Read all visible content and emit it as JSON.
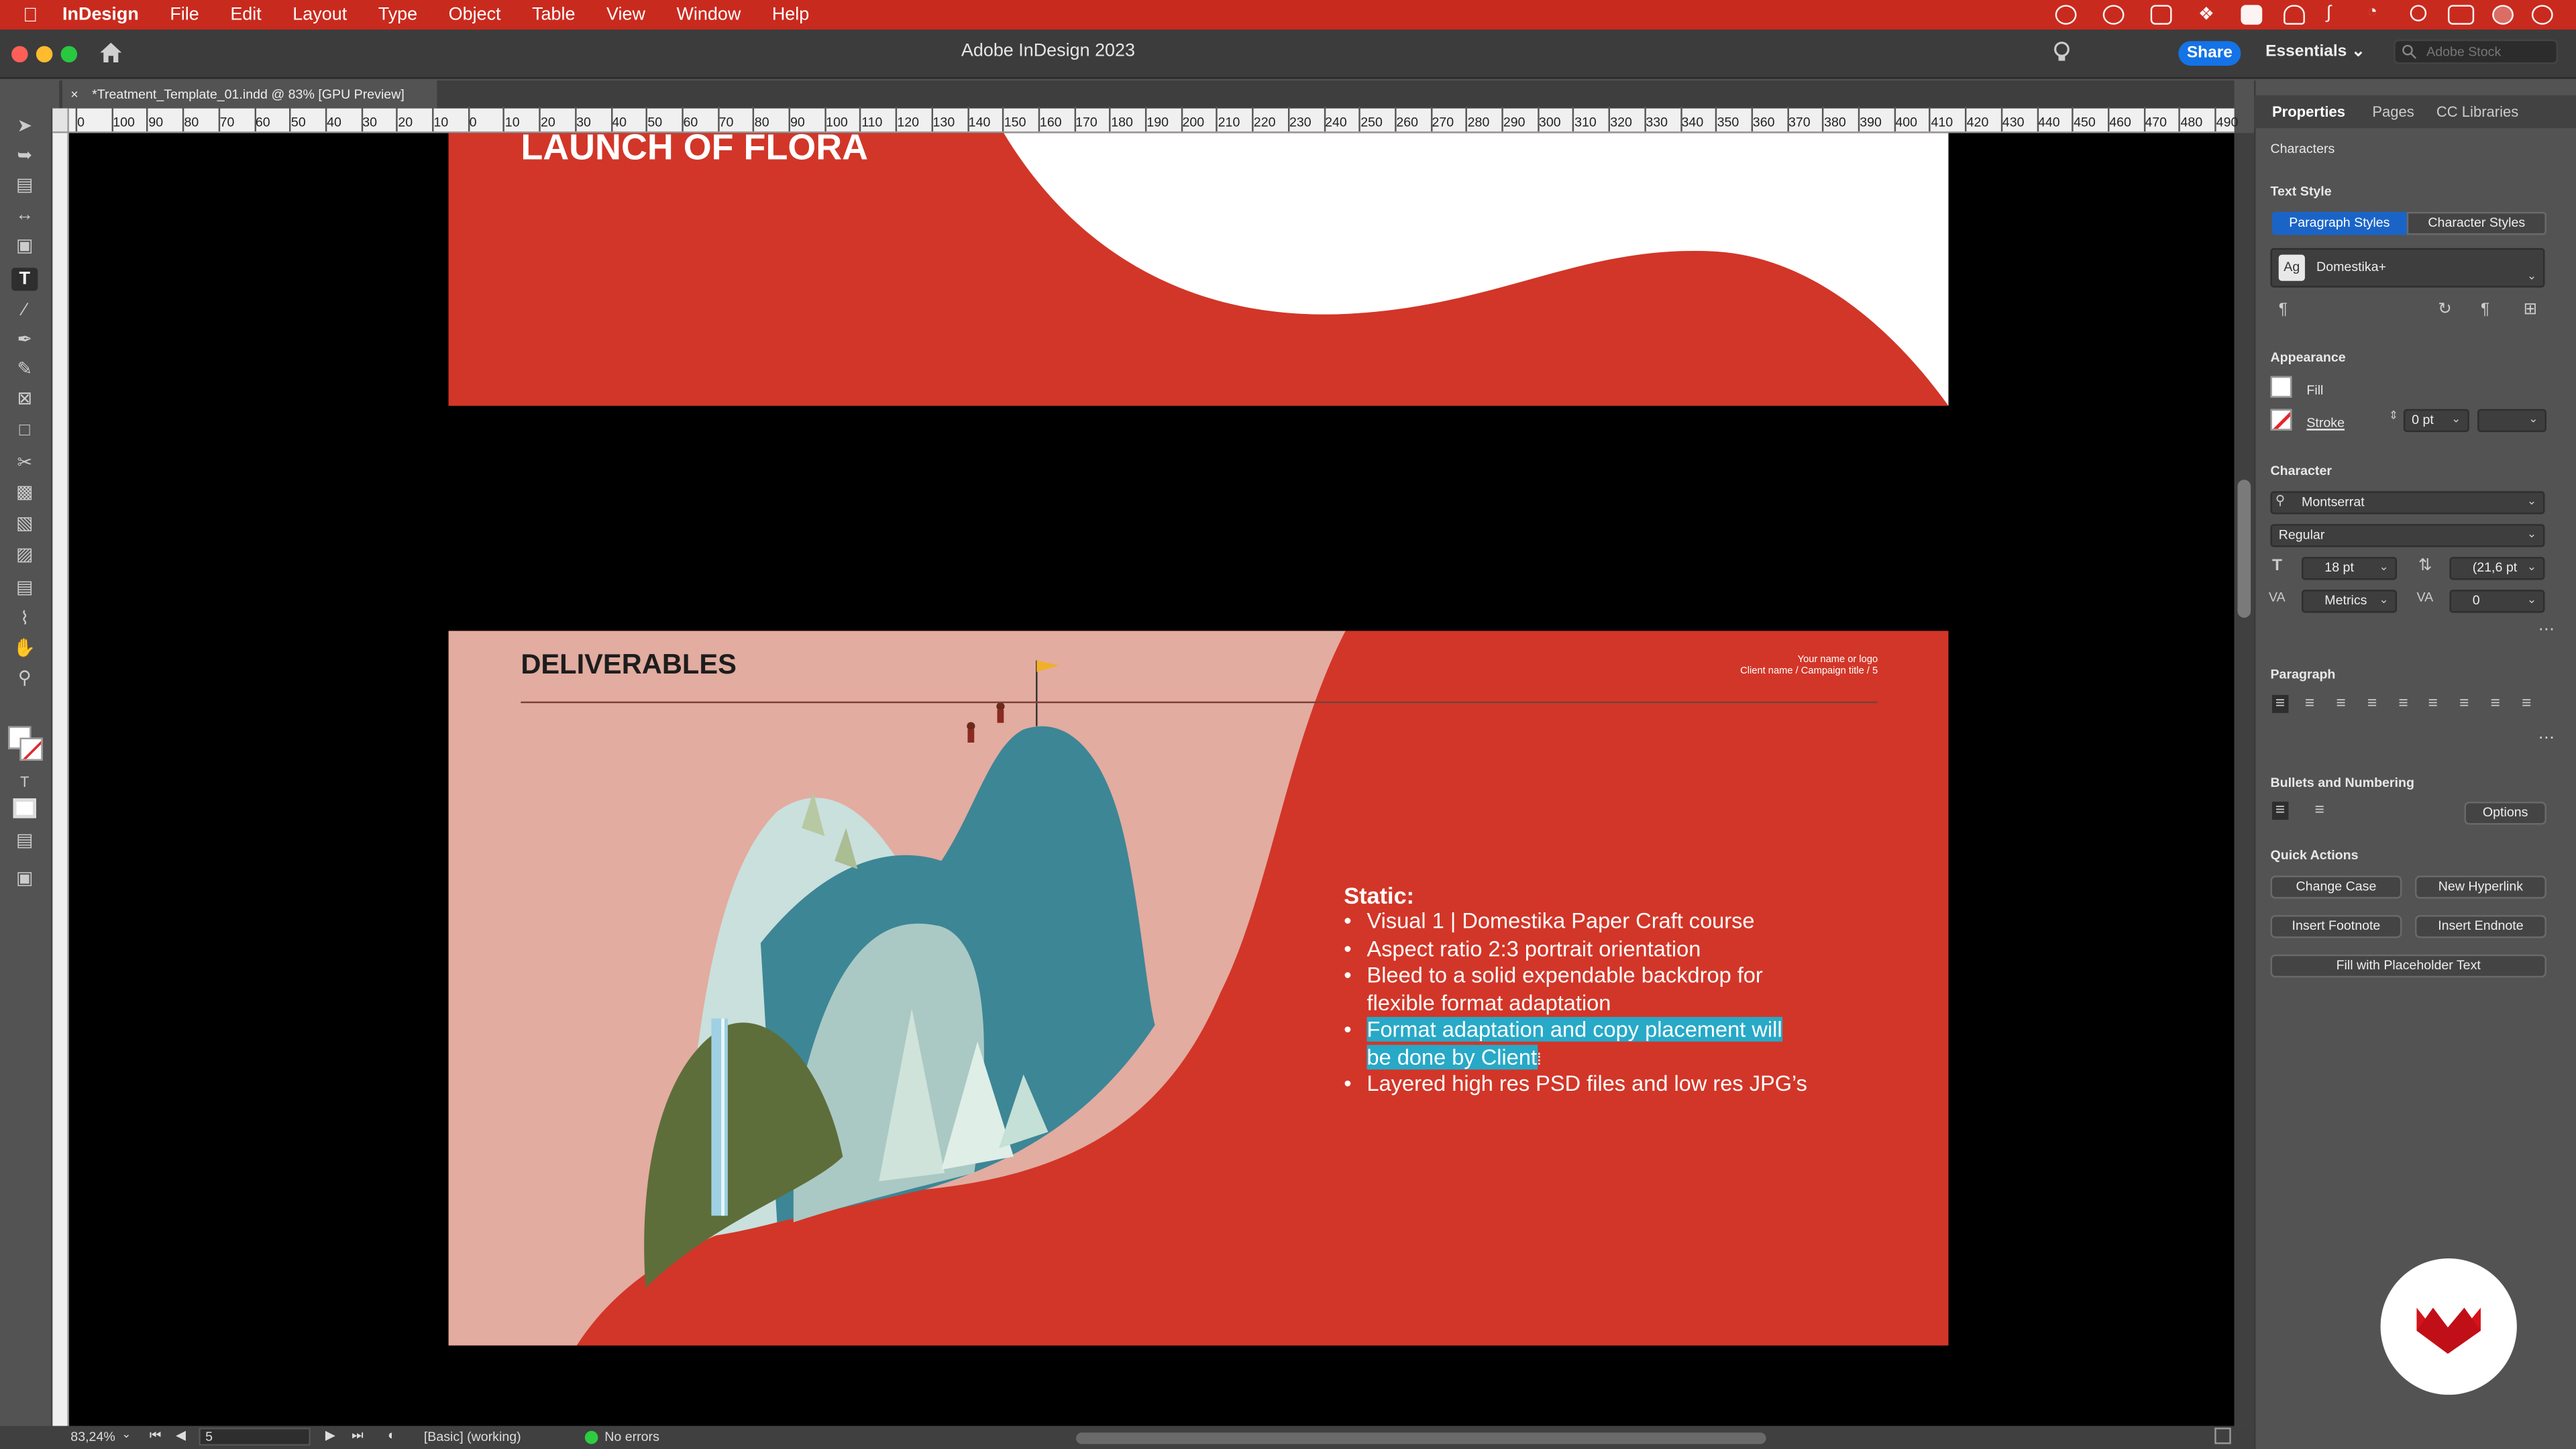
{
  "menubar": {
    "app": "InDesign",
    "items": [
      "File",
      "Edit",
      "Layout",
      "Type",
      "Object",
      "Table",
      "View",
      "Window",
      "Help"
    ]
  },
  "titlebar": {
    "title": "Adobe InDesign 2023",
    "share": "Share",
    "workspace": "Essentials",
    "search_placeholder": "Adobe Stock"
  },
  "document_tab": {
    "close": "×",
    "label": "*Treatment_Template_01.indd @ 83% [GPU Preview]"
  },
  "ruler": {
    "h_ticks": [
      "0",
      "100",
      "90",
      "80",
      "70",
      "60",
      "50",
      "40",
      "30",
      "20",
      "10",
      "0",
      "10",
      "20",
      "30",
      "40",
      "50",
      "60",
      "70",
      "80",
      "90",
      "100",
      "110",
      "120",
      "130",
      "140",
      "150",
      "160",
      "170",
      "180",
      "190",
      "200",
      "210",
      "220",
      "230",
      "240",
      "250",
      "260",
      "270",
      "280",
      "290",
      "300",
      "310",
      "320",
      "330",
      "340",
      "350",
      "360",
      "370",
      "380",
      "390",
      "400",
      "410",
      "420",
      "430",
      "440",
      "450",
      "460",
      "470",
      "480",
      "490"
    ]
  },
  "page1": {
    "title": "LAUNCH OF FLORA"
  },
  "page2": {
    "title": "DELIVERABLES",
    "brand_line1": "Your  name or logo",
    "brand_line2": "Client name / Campaign title  / 5",
    "static_title": "Static:",
    "bullets": [
      "Visual 1 | Domestika Paper Craft course",
      "Aspect ratio 2:3 portrait orientation",
      "Bleed to a solid expendable backdrop for",
      "flexible format adaptation",
      "Format adaptation and copy placement will",
      "be done by Client",
      "Layered high res PSD files and low res JPG’s"
    ],
    "bullet_marker": "•"
  },
  "status": {
    "zoom": "83,24%",
    "page": "5",
    "profile": "[Basic] (working)",
    "errors": "No errors"
  },
  "panel": {
    "tabs": [
      "Properties",
      "Pages",
      "CC Libraries"
    ],
    "characters_label": "Characters",
    "text_style_label": "Text Style",
    "paragraph_styles": "Paragraph Styles",
    "character_styles": "Character Styles",
    "style_name": "Domestika+",
    "style_icon_text": "Ag",
    "appearance_label": "Appearance",
    "fill_label": "Fill",
    "stroke_label": "Stroke",
    "stroke_value": "0 pt",
    "character_label": "Character",
    "font": "Montserrat",
    "font_style": "Regular",
    "font_size": "18 pt",
    "leading": "(21,6 pt",
    "kerning": "Metrics",
    "tracking": "0",
    "paragraph_label": "Paragraph",
    "bullets_label": "Bullets and Numbering",
    "options": "Options",
    "quick_actions_label": "Quick Actions",
    "change_case": "Change Case",
    "new_hyperlink": "New Hyperlink",
    "insert_footnote": "Insert Footnote",
    "insert_endnote": "Insert Endnote",
    "fill_placeholder": "Fill with Placeholder Text"
  },
  "colors": {
    "accent_red": "#d23628",
    "menubar_red": "#c92a1e",
    "selection": "#27a9c7",
    "pink": "#e2aca0",
    "teal": "#3d8696"
  }
}
